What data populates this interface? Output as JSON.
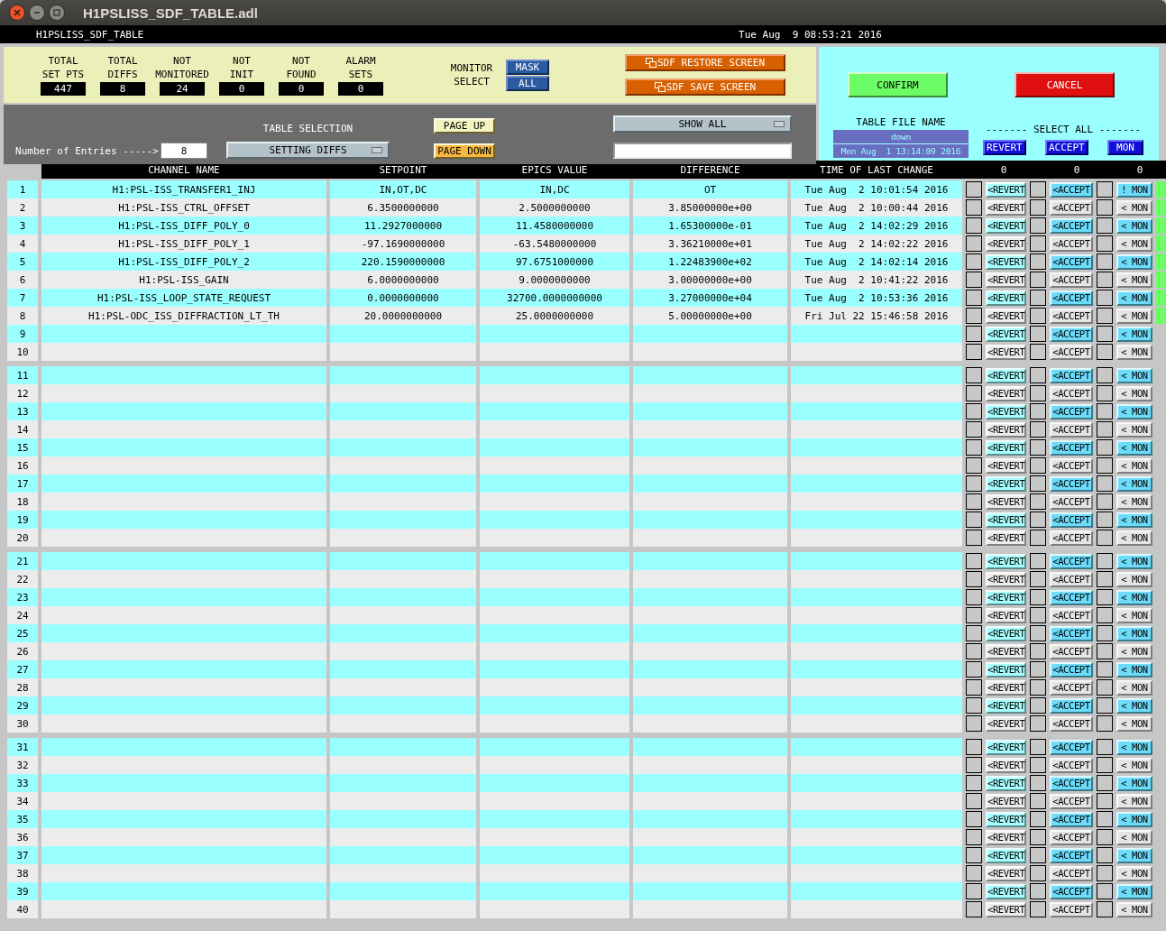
{
  "window": {
    "title": "H1PSLISS_SDF_TABLE.adl"
  },
  "header_bar": {
    "screen_name": "H1PSLISS_SDF_TABLE",
    "datetime": "Tue Aug  9 08:53:21 2016"
  },
  "stats": [
    {
      "label_lines": [
        "TOTAL",
        "SET PTS"
      ],
      "value": "447"
    },
    {
      "label_lines": [
        "TOTAL",
        "DIFFS"
      ],
      "value": "8"
    },
    {
      "label_lines": [
        "NOT",
        "MONITORED"
      ],
      "value": "24"
    },
    {
      "label_lines": [
        "NOT",
        "INIT"
      ],
      "value": "0"
    },
    {
      "label_lines": [
        "NOT",
        "FOUND"
      ],
      "value": "0"
    },
    {
      "label_lines": [
        "ALARM",
        "SETS"
      ],
      "value": "0"
    }
  ],
  "monitor_select": {
    "label_lines": [
      "MONITOR",
      "SELECT"
    ],
    "buttons": [
      "MASK",
      "ALL"
    ]
  },
  "screen_buttons": [
    "SDF RESTORE SCREEN",
    "SDF SAVE SCREEN"
  ],
  "entries": {
    "label": "Number of Entries ----->",
    "value": "8"
  },
  "table_selection": {
    "label": "TABLE SELECTION",
    "value": "SETTING DIFFS"
  },
  "page_buttons": [
    {
      "label": "PAGE UP",
      "kind": "up"
    },
    {
      "label": "PAGE DOWN",
      "kind": "down"
    }
  ],
  "show_menu": {
    "value": "SHOW ALL"
  },
  "actions": [
    {
      "label": "CONFIRM",
      "kind": "confirm"
    },
    {
      "label": "CANCEL",
      "kind": "cancel"
    }
  ],
  "table_file": {
    "label": "TABLE FILE NAME",
    "name": "down",
    "time": "Mon Aug  1 13:14:09 2016"
  },
  "select_all": {
    "label": "------- SELECT ALL -------",
    "buttons": [
      "REVERT",
      "ACCEPT",
      "MON"
    ]
  },
  "table": {
    "columns": [
      "CHANNEL NAME",
      "SETPOINT",
      "EPICS VALUE",
      "DIFFERENCE",
      "TIME OF LAST CHANGE"
    ],
    "counts": [
      "0",
      "0",
      "0"
    ],
    "rows": [
      {
        "n": "1",
        "channel": "H1:PSL-ISS_TRANSFER1_INJ",
        "setpoint": "IN,OT,DC",
        "epics": "IN,DC",
        "difference": "OT",
        "time": "Tue Aug  2 10:01:54 2016",
        "revert": "<REVERT",
        "accept": "<ACCEPT",
        "mon": "! MON",
        "revert_checked": false,
        "accept_checked": false,
        "mon_checked": false,
        "indicator_on": true
      },
      {
        "n": "2",
        "channel": "H1:PSL-ISS_CTRL_OFFSET",
        "setpoint": "6.3500000000",
        "epics": "2.5000000000",
        "difference": "3.85000000e+00",
        "time": "Tue Aug  2 10:00:44 2016",
        "revert": "<REVERT",
        "accept": "<ACCEPT",
        "mon": "< MON",
        "revert_checked": false,
        "accept_checked": false,
        "mon_checked": false,
        "indicator_on": true
      },
      {
        "n": "3",
        "channel": "H1:PSL-ISS_DIFF_POLY_0",
        "setpoint": "11.2927000000",
        "epics": "11.4580000000",
        "difference": "1.65300000e-01",
        "time": "Tue Aug  2 14:02:29 2016",
        "revert": "<REVERT",
        "accept": "<ACCEPT",
        "mon": "< MON",
        "revert_checked": false,
        "accept_checked": false,
        "mon_checked": false,
        "indicator_on": true
      },
      {
        "n": "4",
        "channel": "H1:PSL-ISS_DIFF_POLY_1",
        "setpoint": "-97.1690000000",
        "epics": "-63.5480000000",
        "difference": "3.36210000e+01",
        "time": "Tue Aug  2 14:02:22 2016",
        "revert": "<REVERT",
        "accept": "<ACCEPT",
        "mon": "< MON",
        "revert_checked": false,
        "accept_checked": false,
        "mon_checked": false,
        "indicator_on": true
      },
      {
        "n": "5",
        "channel": "H1:PSL-ISS_DIFF_POLY_2",
        "setpoint": "220.1590000000",
        "epics": "97.6751000000",
        "difference": "1.22483900e+02",
        "time": "Tue Aug  2 14:02:14 2016",
        "revert": "<REVERT",
        "accept": "<ACCEPT",
        "mon": "< MON",
        "revert_checked": false,
        "accept_checked": false,
        "mon_checked": false,
        "indicator_on": true
      },
      {
        "n": "6",
        "channel": "H1:PSL-ISS_GAIN",
        "setpoint": "6.0000000000",
        "epics": "9.0000000000",
        "difference": "3.00000000e+00",
        "time": "Tue Aug  2 10:41:22 2016",
        "revert": "<REVERT",
        "accept": "<ACCEPT",
        "mon": "< MON",
        "revert_checked": false,
        "accept_checked": false,
        "mon_checked": false,
        "indicator_on": true
      },
      {
        "n": "7",
        "channel": "H1:PSL-ISS_LOOP_STATE_REQUEST",
        "setpoint": "0.0000000000",
        "epics": "32700.0000000000",
        "difference": "3.27000000e+04",
        "time": "Tue Aug  2 10:53:36 2016",
        "revert": "<REVERT",
        "accept": "<ACCEPT",
        "mon": "< MON",
        "revert_checked": false,
        "accept_checked": false,
        "mon_checked": false,
        "indicator_on": true
      },
      {
        "n": "8",
        "channel": "H1:PSL-ODC_ISS_DIFFRACTION_LT_TH",
        "setpoint": "20.0000000000",
        "epics": "25.0000000000",
        "difference": "5.00000000e+00",
        "time": "Fri Jul 22 15:46:58 2016",
        "revert": "<REVERT",
        "accept": "<ACCEPT",
        "mon": "< MON",
        "revert_checked": false,
        "accept_checked": false,
        "mon_checked": false,
        "indicator_on": true
      },
      {
        "n": "9",
        "revert": "<REVERT",
        "accept": "<ACCEPT",
        "mon": "< MON",
        "revert_checked": false,
        "accept_checked": false,
        "mon_checked": false,
        "indicator_on": false
      },
      {
        "n": "10",
        "revert": "<REVERT",
        "accept": "<ACCEPT",
        "mon": "< MON",
        "revert_checked": false,
        "accept_checked": false,
        "mon_checked": false,
        "indicator_on": false
      },
      {
        "n": "11",
        "revert": "<REVERT",
        "accept": "<ACCEPT",
        "mon": "< MON",
        "revert_checked": false,
        "accept_checked": false,
        "mon_checked": false,
        "indicator_on": false
      },
      {
        "n": "12",
        "revert": "<REVERT",
        "accept": "<ACCEPT",
        "mon": "< MON",
        "revert_checked": false,
        "accept_checked": false,
        "mon_checked": false,
        "indicator_on": false
      },
      {
        "n": "13",
        "revert": "<REVERT",
        "accept": "<ACCEPT",
        "mon": "< MON",
        "revert_checked": false,
        "accept_checked": false,
        "mon_checked": false,
        "indicator_on": false
      },
      {
        "n": "14",
        "revert": "<REVERT",
        "accept": "<ACCEPT",
        "mon": "< MON",
        "revert_checked": false,
        "accept_checked": false,
        "mon_checked": false,
        "indicator_on": false
      },
      {
        "n": "15",
        "revert": "<REVERT",
        "accept": "<ACCEPT",
        "mon": "< MON",
        "revert_checked": false,
        "accept_checked": false,
        "mon_checked": false,
        "indicator_on": false
      },
      {
        "n": "16",
        "revert": "<REVERT",
        "accept": "<ACCEPT",
        "mon": "< MON",
        "revert_checked": false,
        "accept_checked": false,
        "mon_checked": false,
        "indicator_on": false
      },
      {
        "n": "17",
        "revert": "<REVERT",
        "accept": "<ACCEPT",
        "mon": "< MON",
        "revert_checked": false,
        "accept_checked": false,
        "mon_checked": false,
        "indicator_on": false
      },
      {
        "n": "18",
        "revert": "<REVERT",
        "accept": "<ACCEPT",
        "mon": "< MON",
        "revert_checked": false,
        "accept_checked": false,
        "mon_checked": false,
        "indicator_on": false
      },
      {
        "n": "19",
        "revert": "<REVERT",
        "accept": "<ACCEPT",
        "mon": "< MON",
        "revert_checked": false,
        "accept_checked": false,
        "mon_checked": false,
        "indicator_on": false
      },
      {
        "n": "20",
        "revert": "<REVERT",
        "accept": "<ACCEPT",
        "mon": "< MON",
        "revert_checked": false,
        "accept_checked": false,
        "mon_checked": false,
        "indicator_on": false
      },
      {
        "n": "21",
        "revert": "<REVERT",
        "accept": "<ACCEPT",
        "mon": "< MON",
        "revert_checked": false,
        "accept_checked": false,
        "mon_checked": false,
        "indicator_on": false
      },
      {
        "n": "22",
        "revert": "<REVERT",
        "accept": "<ACCEPT",
        "mon": "< MON",
        "revert_checked": false,
        "accept_checked": false,
        "mon_checked": false,
        "indicator_on": false
      },
      {
        "n": "23",
        "revert": "<REVERT",
        "accept": "<ACCEPT",
        "mon": "< MON",
        "revert_checked": false,
        "accept_checked": false,
        "mon_checked": false,
        "indicator_on": false
      },
      {
        "n": "24",
        "revert": "<REVERT",
        "accept": "<ACCEPT",
        "mon": "< MON",
        "revert_checked": false,
        "accept_checked": false,
        "mon_checked": false,
        "indicator_on": false
      },
      {
        "n": "25",
        "revert": "<REVERT",
        "accept": "<ACCEPT",
        "mon": "< MON",
        "revert_checked": false,
        "accept_checked": false,
        "mon_checked": false,
        "indicator_on": false
      },
      {
        "n": "26",
        "revert": "<REVERT",
        "accept": "<ACCEPT",
        "mon": "< MON",
        "revert_checked": false,
        "accept_checked": false,
        "mon_checked": false,
        "indicator_on": false
      },
      {
        "n": "27",
        "revert": "<REVERT",
        "accept": "<ACCEPT",
        "mon": "< MON",
        "revert_checked": false,
        "accept_checked": false,
        "mon_checked": false,
        "indicator_on": false
      },
      {
        "n": "28",
        "revert": "<REVERT",
        "accept": "<ACCEPT",
        "mon": "< MON",
        "revert_checked": false,
        "accept_checked": false,
        "mon_checked": false,
        "indicator_on": false
      },
      {
        "n": "29",
        "revert": "<REVERT",
        "accept": "<ACCEPT",
        "mon": "< MON",
        "revert_checked": false,
        "accept_checked": false,
        "mon_checked": false,
        "indicator_on": false
      },
      {
        "n": "30",
        "revert": "<REVERT",
        "accept": "<ACCEPT",
        "mon": "< MON",
        "revert_checked": false,
        "accept_checked": false,
        "mon_checked": false,
        "indicator_on": false
      },
      {
        "n": "31",
        "revert": "<REVERT",
        "accept": "<ACCEPT",
        "mon": "< MON",
        "revert_checked": false,
        "accept_checked": false,
        "mon_checked": false,
        "indicator_on": false
      },
      {
        "n": "32",
        "revert": "<REVERT",
        "accept": "<ACCEPT",
        "mon": "< MON",
        "revert_checked": false,
        "accept_checked": false,
        "mon_checked": false,
        "indicator_on": false
      },
      {
        "n": "33",
        "revert": "<REVERT",
        "accept": "<ACCEPT",
        "mon": "< MON",
        "revert_checked": false,
        "accept_checked": false,
        "mon_checked": false,
        "indicator_on": false
      },
      {
        "n": "34",
        "revert": "<REVERT",
        "accept": "<ACCEPT",
        "mon": "< MON",
        "revert_checked": false,
        "accept_checked": false,
        "mon_checked": false,
        "indicator_on": false
      },
      {
        "n": "35",
        "revert": "<REVERT",
        "accept": "<ACCEPT",
        "mon": "< MON",
        "revert_checked": false,
        "accept_checked": false,
        "mon_checked": false,
        "indicator_on": false
      },
      {
        "n": "36",
        "revert": "<REVERT",
        "accept": "<ACCEPT",
        "mon": "< MON",
        "revert_checked": false,
        "accept_checked": false,
        "mon_checked": false,
        "indicator_on": false
      },
      {
        "n": "37",
        "revert": "<REVERT",
        "accept": "<ACCEPT",
        "mon": "< MON",
        "revert_checked": false,
        "accept_checked": false,
        "mon_checked": false,
        "indicator_on": false
      },
      {
        "n": "38",
        "revert": "<REVERT",
        "accept": "<ACCEPT",
        "mon": "< MON",
        "revert_checked": false,
        "accept_checked": false,
        "mon_checked": false,
        "indicator_on": false
      },
      {
        "n": "39",
        "revert": "<REVERT",
        "accept": "<ACCEPT",
        "mon": "< MON",
        "revert_checked": false,
        "accept_checked": false,
        "mon_checked": false,
        "indicator_on": false
      },
      {
        "n": "40",
        "revert": "<REVERT",
        "accept": "<ACCEPT",
        "mon": "< MON",
        "revert_checked": false,
        "accept_checked": false,
        "mon_checked": false,
        "indicator_on": false
      }
    ]
  }
}
